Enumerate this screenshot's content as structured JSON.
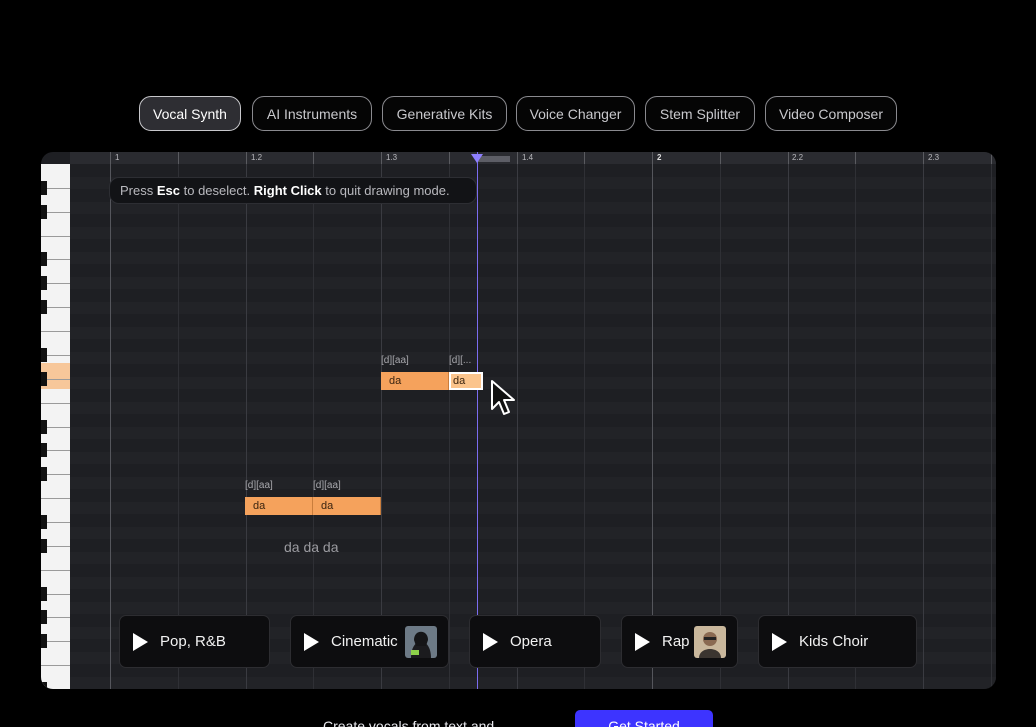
{
  "tabs": [
    {
      "label": "Vocal Synth",
      "active": true
    },
    {
      "label": "AI Instruments",
      "active": false
    },
    {
      "label": "Generative Kits",
      "active": false
    },
    {
      "label": "Voice Changer",
      "active": false
    },
    {
      "label": "Stem Splitter",
      "active": false
    },
    {
      "label": "Video Composer",
      "active": false
    }
  ],
  "ruler": {
    "ticks": [
      "1",
      "1.2",
      "1.3",
      "1.4",
      "2",
      "2.2",
      "2.3"
    ]
  },
  "hint": {
    "press": "Press",
    "esc": "Esc",
    "mid": "to deselect.",
    "right_click": "Right Click",
    "end": "to quit drawing mode."
  },
  "notes": [
    {
      "phonemes": "[d][aa]",
      "lyric": "da"
    },
    {
      "phonemes": "[d][...",
      "lyric": "da"
    },
    {
      "phonemes": "[d][aa]",
      "lyric": "da"
    },
    {
      "phonemes": "[d][aa]",
      "lyric": "da"
    }
  ],
  "lyric_text": "da da da",
  "presets": [
    {
      "label": "Pop, R&B",
      "has_thumb": false
    },
    {
      "label": "Cinematic",
      "has_thumb": true
    },
    {
      "label": "Opera",
      "has_thumb": false
    },
    {
      "label": "Rap",
      "has_thumb": true
    },
    {
      "label": "Kids Choir",
      "has_thumb": false
    }
  ],
  "footer": {
    "text": "Create vocals from text and",
    "cta": "Get Started"
  },
  "colors": {
    "accent": "#3d34ff",
    "note": "#f5a25c",
    "playhead": "#7b6cf0",
    "background": "#000000",
    "editor": "#1e1f23"
  }
}
